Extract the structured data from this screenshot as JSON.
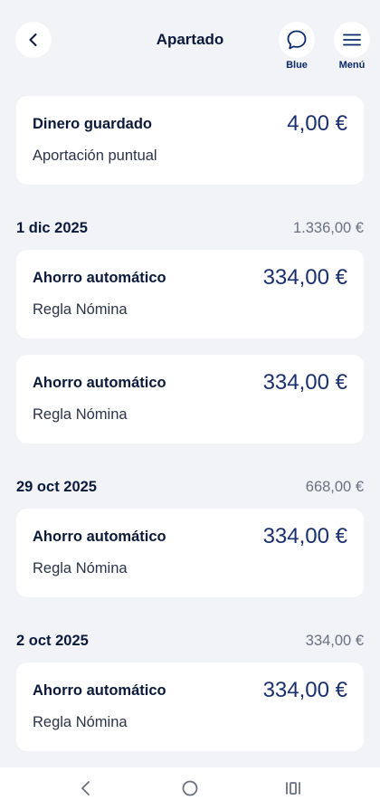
{
  "header": {
    "title": "Apartado",
    "blue_label": "Blue",
    "menu_label": "Menú"
  },
  "summary": {
    "title": "Dinero guardado",
    "subtitle": "Aportación puntual",
    "amount": "4,00 €"
  },
  "groups": [
    {
      "date": "1 dic 2025",
      "total": "1.336,00 €",
      "items": [
        {
          "title": "Ahorro automático",
          "subtitle": "Regla Nómina",
          "amount": "334,00 €"
        },
        {
          "title": "Ahorro automático",
          "subtitle": "Regla Nómina",
          "amount": "334,00 €"
        }
      ]
    },
    {
      "date": "29 oct 2025",
      "total": "668,00 €",
      "items": [
        {
          "title": "Ahorro automático",
          "subtitle": "Regla Nómina",
          "amount": "334,00 €"
        }
      ]
    },
    {
      "date": "2 oct 2025",
      "total": "334,00 €",
      "items": [
        {
          "title": "Ahorro automático",
          "subtitle": "Regla Nómina",
          "amount": "334,00 €"
        }
      ]
    }
  ],
  "icons": {
    "back": "chevron-left-icon",
    "blue": "chat-bubble-icon",
    "menu": "hamburger-menu-icon",
    "nav_back": "nav-back-icon",
    "nav_home": "nav-home-icon",
    "nav_recent": "nav-recent-apps-icon"
  }
}
